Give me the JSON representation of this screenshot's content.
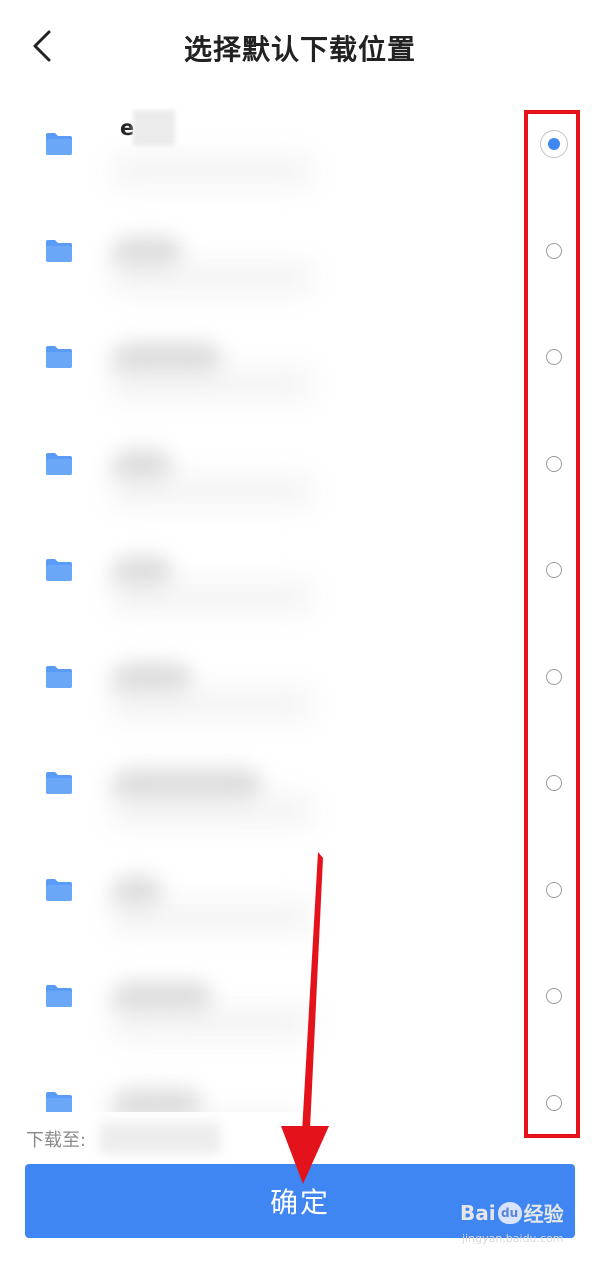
{
  "header": {
    "back_icon": "chevron-left-icon",
    "title": "选择默认下载位置"
  },
  "folders": [
    {
      "name": "e    d",
      "selected": true
    },
    {
      "name": "",
      "selected": false
    },
    {
      "name": "",
      "selected": false
    },
    {
      "name": "",
      "selected": false
    },
    {
      "name": "",
      "selected": false
    },
    {
      "name": "",
      "selected": false
    },
    {
      "name": "",
      "selected": false
    },
    {
      "name": "",
      "selected": false
    },
    {
      "name": "",
      "selected": false
    },
    {
      "name": "",
      "selected": false
    }
  ],
  "footer": {
    "download_to_label": "下载至:",
    "confirm_label": "确定"
  },
  "watermark": {
    "brand": "Bai",
    "brand_suffix": "经验",
    "url": "jingyan.baidu.com"
  },
  "colors": {
    "accent": "#3f86f2",
    "folder": "#5a9cf5",
    "annotation": "#e3121b"
  }
}
